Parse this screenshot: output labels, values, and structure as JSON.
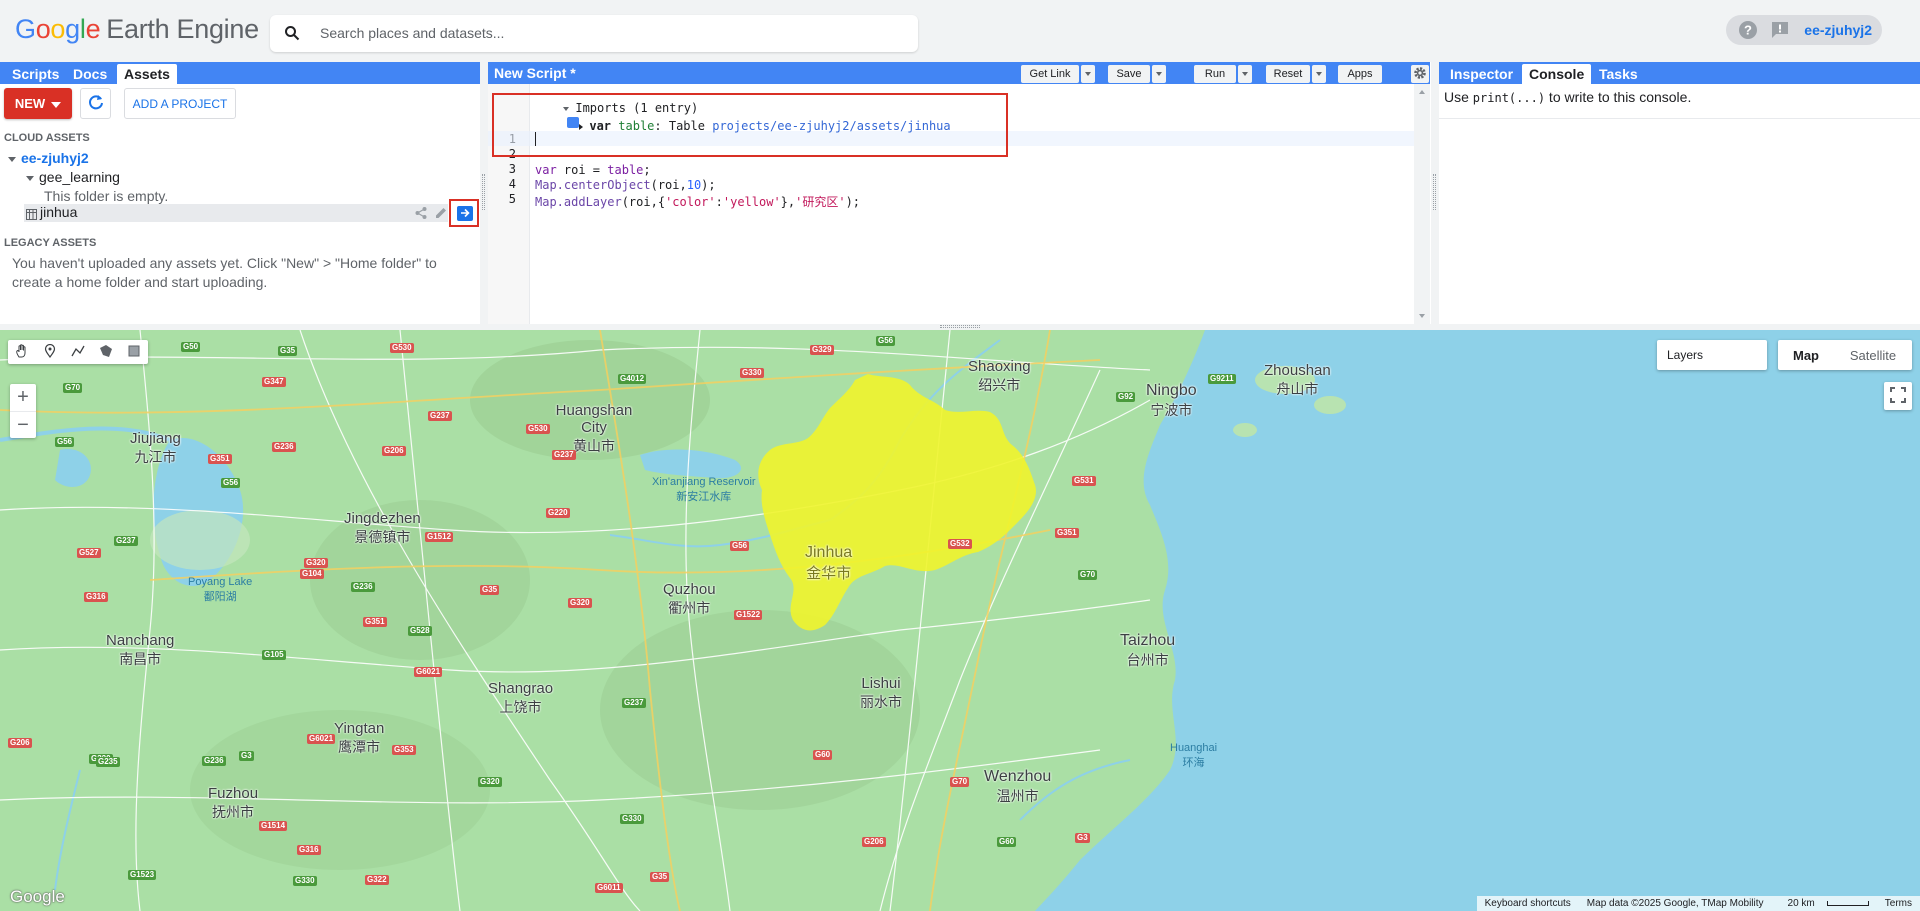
{
  "app": {
    "logo_google": "Google",
    "logo_ee": "Earth Engine"
  },
  "search": {
    "placeholder": "Search places and datasets..."
  },
  "header": {
    "user": "ee-zjuhyj2"
  },
  "left": {
    "tabs": [
      "Scripts",
      "Docs",
      "Assets"
    ],
    "new_label": "NEW",
    "add_project_label": "ADD A PROJECT",
    "cloud_assets": "CLOUD ASSETS",
    "project": "ee-zjuhyj2",
    "folder": "gee_learning",
    "folder_empty": "This folder is empty.",
    "asset": "jinhua",
    "legacy_assets": "LEGACY ASSETS",
    "legacy_text": "You haven't uploaded any assets yet. Click \"New\" > \"Home folder\" to create a home folder and start uploading."
  },
  "editor": {
    "title": "New Script *",
    "buttons": {
      "get_link": "Get Link",
      "save": "Save",
      "run": "Run",
      "reset": "Reset",
      "apps": "Apps"
    },
    "imports_header": "Imports (1 entry)",
    "import_kw": "var",
    "import_name": "table",
    "import_type": ": Table",
    "import_path": "projects/ee-zjuhyj2/assets/jinhua",
    "line_numbers": [
      "1",
      "2",
      "3",
      "4",
      "5"
    ],
    "code": {
      "l3_kw": "var",
      "l3_rest": " roi = ",
      "l3_var": "table",
      "l3_end": ";",
      "l4_obj": "Map.centerObject",
      "l4_args": "(roi,",
      "l4_num": "10",
      "l4_end": ");",
      "l5_obj": "Map.addLayer",
      "l5_a": "(roi,{",
      "l5_k": "'color'",
      "l5_c": ":",
      "l5_v": "'yellow'",
      "l5_b": "},",
      "l5_s": "'研究区'",
      "l5_end": ");"
    }
  },
  "right": {
    "tabs": [
      "Inspector",
      "Console",
      "Tasks"
    ],
    "console_pre": "Use ",
    "console_code": "print(...)",
    "console_post": " to write to this console."
  },
  "map": {
    "layers_label": "Layers",
    "map_type": [
      "Map",
      "Satellite"
    ],
    "google": "Google",
    "attribution": [
      "Keyboard shortcuts",
      "Map data ©2025 Google, TMap Mobility",
      "20 km",
      "Terms"
    ],
    "cities": [
      {
        "en": "Shaoxing",
        "zh": "绍兴市"
      },
      {
        "en": "Ningbo",
        "zh": "宁波市"
      },
      {
        "en": "Zhoushan",
        "zh": "舟山市"
      },
      {
        "en": "Huangshan City",
        "zh": "黄山市"
      },
      {
        "en": "Jiujiang",
        "zh": "九江市"
      },
      {
        "en": "Jingdezhen",
        "zh": "景德镇市"
      },
      {
        "en": "Jinhua",
        "zh": "金华市"
      },
      {
        "en": "Quzhou",
        "zh": "衢州市"
      },
      {
        "en": "Nanchang",
        "zh": "南昌市"
      },
      {
        "en": "Taizhou",
        "zh": "台州市"
      },
      {
        "en": "Lishui",
        "zh": "丽水市"
      },
      {
        "en": "Shangrao",
        "zh": "上饶市"
      },
      {
        "en": "Yingtan",
        "zh": "鹰潭市"
      },
      {
        "en": "Fuzhou",
        "zh": "抚州市"
      },
      {
        "en": "Wenzhou",
        "zh": "温州市"
      }
    ],
    "water": [
      {
        "en": "Xin'anjiang Reservoir",
        "zh": "新安江水库"
      },
      {
        "en": "Poyang Lake",
        "zh": "鄱阳湖"
      },
      {
        "en": "Huanghai",
        "zh": "环海"
      }
    ],
    "roads": [
      "G50",
      "G35",
      "G530",
      "G330",
      "G329",
      "G56",
      "G70",
      "G347",
      "G4012",
      "G237",
      "G530",
      "G237",
      "G92",
      "G9211",
      "G56",
      "G351",
      "G236",
      "G206",
      "G56",
      "G1512",
      "G220",
      "G532",
      "G531",
      "G56",
      "G351",
      "G237",
      "G527",
      "G320",
      "G104",
      "G70",
      "G316",
      "G236",
      "G320",
      "G1522",
      "G105",
      "G35",
      "G351",
      "G528",
      "G6021",
      "G237",
      "G206",
      "G6021",
      "G353",
      "G3",
      "G320",
      "G236",
      "G320",
      "G60",
      "G70",
      "G1514",
      "G235",
      "G330",
      "G316",
      "G60",
      "G3",
      "G206",
      "G1523",
      "G330",
      "G322",
      "G6011",
      "G35",
      "G316",
      "G205",
      "G353"
    ]
  }
}
